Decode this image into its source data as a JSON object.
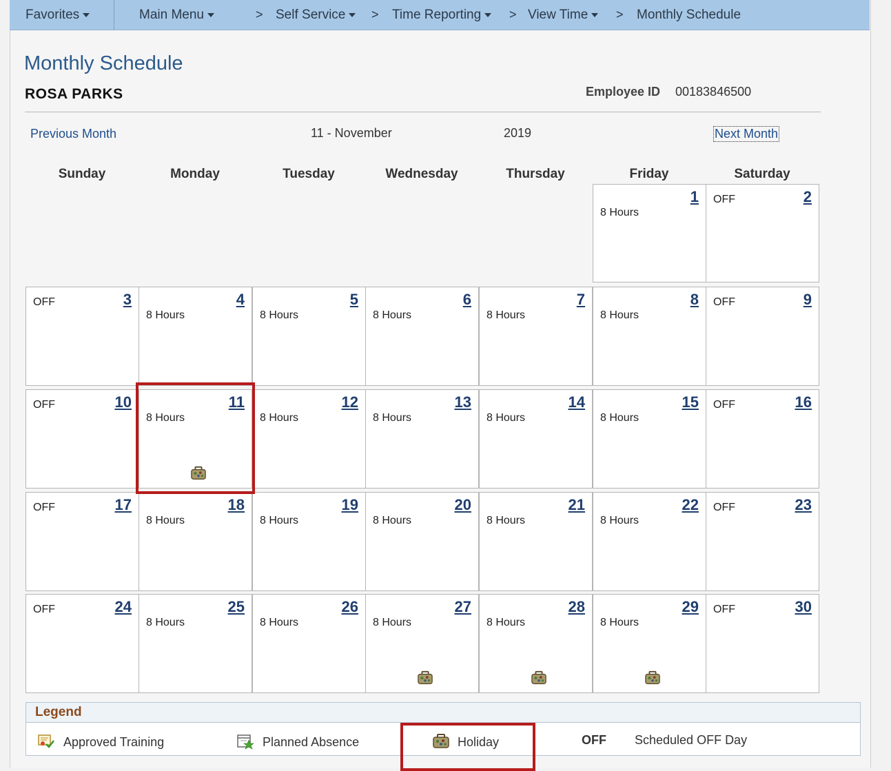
{
  "nav": {
    "favorites": "Favorites",
    "main_menu": "Main Menu",
    "crumb_arrow": ">",
    "self_service": "Self Service",
    "time_reporting": "Time Reporting",
    "view_time": "View Time",
    "current": "Monthly Schedule"
  },
  "page": {
    "title": "Monthly Schedule",
    "employee_name": "ROSA PARKS",
    "employee_id_label": "Employee ID",
    "employee_id": "00183846500"
  },
  "month_nav": {
    "previous": "Previous Month",
    "month": "11 - November",
    "year": "2019",
    "next": "Next Month"
  },
  "weekdays": [
    "Sunday",
    "Monday",
    "Tuesday",
    "Wednesday",
    "Thursday",
    "Friday",
    "Saturday"
  ],
  "days": [
    {
      "day": "1",
      "text": "8 Hours",
      "holiday": false
    },
    {
      "day": "2",
      "text": "OFF",
      "holiday": false
    },
    {
      "day": "3",
      "text": "OFF",
      "holiday": false
    },
    {
      "day": "4",
      "text": "8 Hours",
      "holiday": false
    },
    {
      "day": "5",
      "text": "8 Hours",
      "holiday": false
    },
    {
      "day": "6",
      "text": "8 Hours",
      "holiday": false
    },
    {
      "day": "7",
      "text": "8 Hours",
      "holiday": false
    },
    {
      "day": "8",
      "text": "8 Hours",
      "holiday": false
    },
    {
      "day": "9",
      "text": "OFF",
      "holiday": false
    },
    {
      "day": "10",
      "text": "OFF",
      "holiday": false
    },
    {
      "day": "11",
      "text": "8 Hours",
      "holiday": true
    },
    {
      "day": "12",
      "text": "8 Hours",
      "holiday": false
    },
    {
      "day": "13",
      "text": "8 Hours",
      "holiday": false
    },
    {
      "day": "14",
      "text": "8 Hours",
      "holiday": false
    },
    {
      "day": "15",
      "text": "8 Hours",
      "holiday": false
    },
    {
      "day": "16",
      "text": "OFF",
      "holiday": false
    },
    {
      "day": "17",
      "text": "OFF",
      "holiday": false
    },
    {
      "day": "18",
      "text": "8 Hours",
      "holiday": false
    },
    {
      "day": "19",
      "text": "8 Hours",
      "holiday": false
    },
    {
      "day": "20",
      "text": "8 Hours",
      "holiday": false
    },
    {
      "day": "21",
      "text": "8 Hours",
      "holiday": false
    },
    {
      "day": "22",
      "text": "8 Hours",
      "holiday": false
    },
    {
      "day": "23",
      "text": "OFF",
      "holiday": false
    },
    {
      "day": "24",
      "text": "OFF",
      "holiday": false
    },
    {
      "day": "25",
      "text": "8 Hours",
      "holiday": false
    },
    {
      "day": "26",
      "text": "8 Hours",
      "holiday": false
    },
    {
      "day": "27",
      "text": "8 Hours",
      "holiday": true
    },
    {
      "day": "28",
      "text": "8 Hours",
      "holiday": true
    },
    {
      "day": "29",
      "text": "8 Hours",
      "holiday": true
    },
    {
      "day": "30",
      "text": "OFF",
      "holiday": false
    }
  ],
  "legend": {
    "title": "Legend",
    "approved_training": "Approved Training",
    "planned_absence": "Planned Absence",
    "holiday": "Holiday",
    "off_code": "OFF",
    "off_desc": "Scheduled OFF Day"
  },
  "colors": {
    "nav_bar": "#a7c7e6",
    "link": "#1f4e8c",
    "highlight_box": "#b71c1c",
    "legend_title": "#8a4b1f"
  }
}
